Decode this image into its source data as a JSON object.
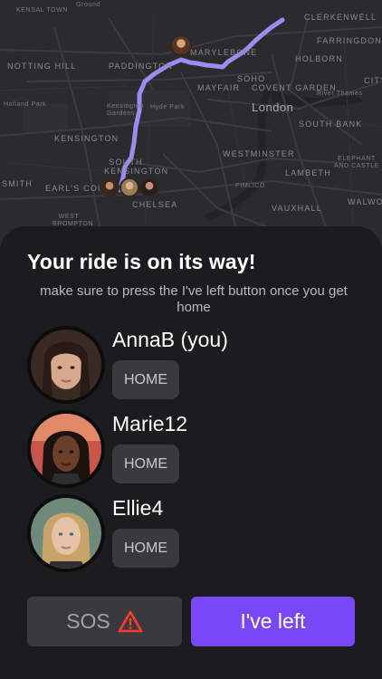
{
  "map": {
    "labels": {
      "kensal_town": "KENSAL TOWN",
      "ground": "Ground",
      "clerkenwell": "CLERKENWELL",
      "farringdon": "FARRINGDON",
      "notting_hill": "NOTTING HILL",
      "paddington": "PADDINGTON",
      "marylebone": "MARYLEBONE",
      "holborn": "HOLBORN",
      "soho": "SOHO",
      "mayfair": "MAYFAIR",
      "covent_garden": "COVENT GARDEN",
      "city": "CITY",
      "river_thames": "River Thames",
      "holland_park": "Holland Park",
      "kensington_gardens": "Kensington Gardens",
      "hyde_park": "Hyde Park",
      "london": "London",
      "south_bank": "SOUTH BANK",
      "kensington": "KENSINGTON",
      "westminster": "WESTMINSTER",
      "south_kensington": "SOUTH KENSINGTON",
      "lambeth": "LAMBETH",
      "elephant_castle": "ELEPHANT AND CASTLE",
      "smith": "SMITH",
      "earls_court": "EARL'S COURT",
      "pimlico": "PIMLICO",
      "walworth": "WALWORTH",
      "chelsea": "CHELSEA",
      "vauxhall": "VAUXHALL",
      "west_brompton": "WEST BROMPTON"
    },
    "route_color": "#9b8cf2"
  },
  "sheet": {
    "title": "Your ride is on its way!",
    "subtitle": "make sure to press the I've left button once you get home",
    "riders": [
      {
        "name": "AnnaB (you)",
        "destination": "HOME"
      },
      {
        "name": "Marie12",
        "destination": "HOME"
      },
      {
        "name": "Ellie4",
        "destination": "HOME"
      }
    ],
    "sos_label": "SOS",
    "left_label": "I've left"
  },
  "colors": {
    "accent": "#7847f6",
    "warning": "#ff3b30",
    "background": "#1c1c1e"
  },
  "icons": {
    "sos": "warning-triangle-icon"
  }
}
